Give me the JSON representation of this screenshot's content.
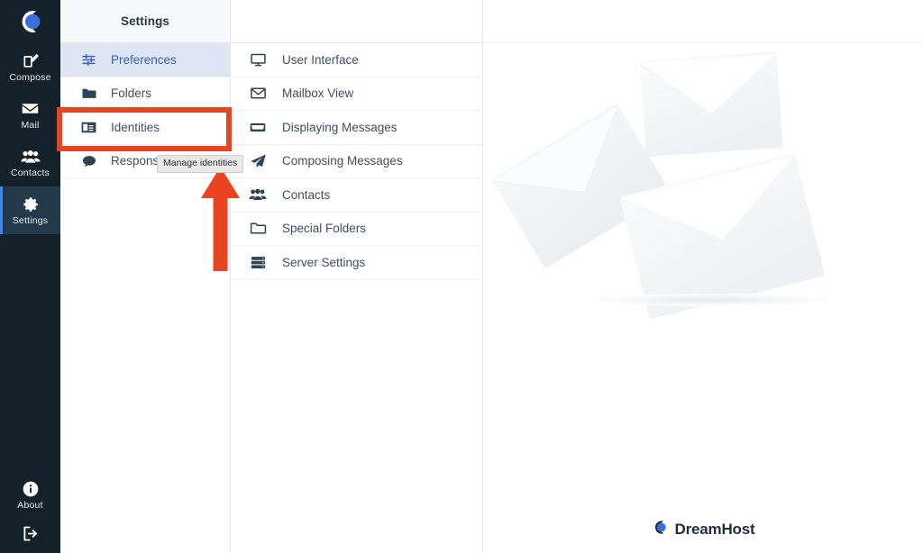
{
  "app": {
    "brand_name": "DreamHost",
    "accent_blue": "#3c87f0",
    "rail_bg": "#14212b",
    "highlight_red": "#e8441f",
    "selected_blue": "#3562c4"
  },
  "rail": {
    "logo_icon": "dreamhost-moon-logo",
    "items": [
      {
        "label": "Compose",
        "icon": "compose-icon",
        "active": false
      },
      {
        "label": "Mail",
        "icon": "envelope-icon",
        "active": false
      },
      {
        "label": "Contacts",
        "icon": "contacts-icon",
        "active": false
      },
      {
        "label": "Settings",
        "icon": "gear-icon",
        "active": true
      }
    ],
    "bottom_items": [
      {
        "label": "About",
        "icon": "info-icon"
      },
      {
        "label": "",
        "icon": "logout-icon"
      }
    ]
  },
  "settings_nav": {
    "title": "Settings",
    "items": [
      {
        "label": "Preferences",
        "icon": "sliders-icon",
        "selected": true
      },
      {
        "label": "Folders",
        "icon": "folder-filled-icon",
        "selected": false
      },
      {
        "label": "Identities",
        "icon": "id-card-icon",
        "selected": false
      },
      {
        "label": "Responses",
        "icon": "speech-bubble-icon",
        "selected": false
      }
    ]
  },
  "settings_list": {
    "items": [
      {
        "label": "User Interface",
        "icon": "monitor-icon"
      },
      {
        "label": "Mailbox View",
        "icon": "envelope-outline-icon"
      },
      {
        "label": "Displaying Messages",
        "icon": "inbox-icon"
      },
      {
        "label": "Composing Messages",
        "icon": "paper-plane-icon"
      },
      {
        "label": "Contacts",
        "icon": "contacts-icon"
      },
      {
        "label": "Special Folders",
        "icon": "folder-outline-icon"
      },
      {
        "label": "Server Settings",
        "icon": "server-icon"
      }
    ]
  },
  "content": {
    "illustration": "three-envelopes-illustration",
    "brand_label": "DreamHost",
    "brand_icon": "dreamhost-moon-logo"
  },
  "annotations": {
    "highlight_target": "Identities",
    "tooltip_text": "Manage identities",
    "arrow_icon": "red-up-arrow"
  }
}
